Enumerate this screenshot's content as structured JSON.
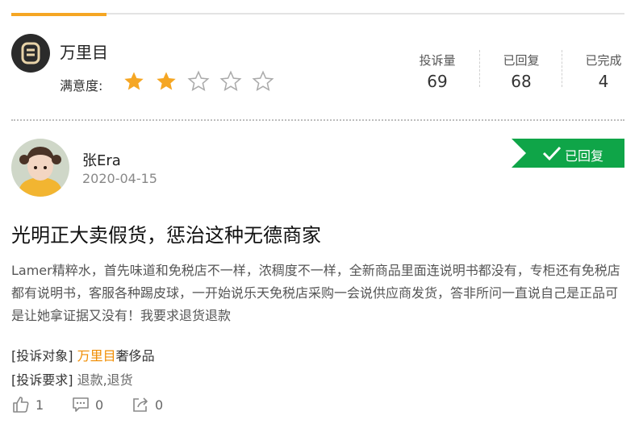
{
  "merchant": {
    "name": "万里目",
    "rating_label": "满意度:",
    "rating": 2,
    "rating_max": 5
  },
  "stats": [
    {
      "label": "投诉量",
      "value": "69"
    },
    {
      "label": "已回复",
      "value": "68"
    },
    {
      "label": "已完成",
      "value": "4"
    }
  ],
  "post": {
    "user": "张Era",
    "date": "2020-04-15",
    "status_badge": "已回复",
    "title": "光明正大卖假货，惩治这种无德商家",
    "body": "Lamer精粹水，首先味道和免税店不一样，浓稠度不一样，全新商品里面连说明书都没有，专柜还有免税店都有说明书，客服各种踢皮球，一开始说乐天免税店采购一会说供应商发货，答非所问一直说自己是正品可是让她拿证据又没有！我要求退货退款",
    "target_label": "[投诉对象]",
    "target_merchant": "万里目",
    "target_suffix": "奢侈品",
    "request_label": "[投诉要求]",
    "request_value": "退款,退货"
  },
  "actions": {
    "likes": "1",
    "comments": "0",
    "shares": "0"
  },
  "colors": {
    "accent": "#f5a623",
    "star_filled": "#f5a623",
    "badge": "#0fa548",
    "link": "#f08c00"
  }
}
